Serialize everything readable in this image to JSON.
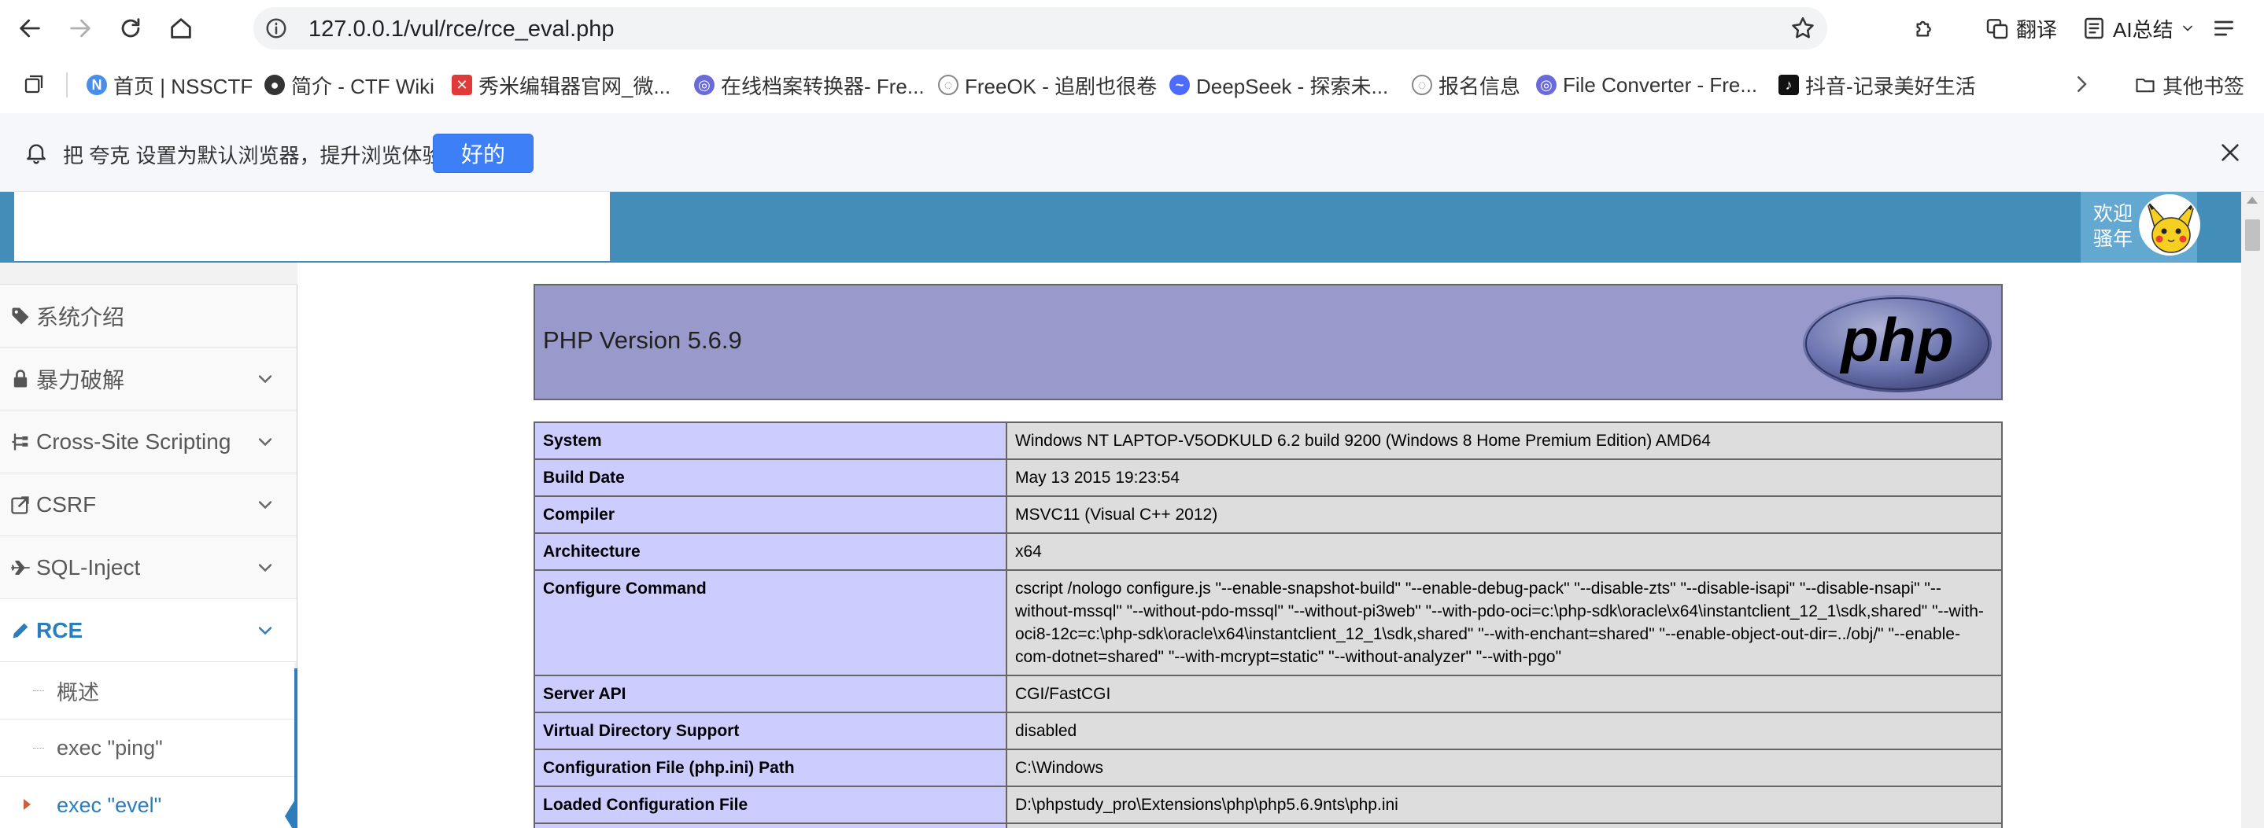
{
  "browser": {
    "url": "127.0.0.1/vul/rce/rce_eval.php",
    "translate_label": "翻译",
    "ai_summary_label": "AI总结"
  },
  "bookmarks": {
    "items": [
      {
        "label": "首页 | NSSCTF",
        "color": "#4a8fe7"
      },
      {
        "label": "简介 - CTF Wiki",
        "color": "#333333"
      },
      {
        "label": "秀米编辑器官网_微...",
        "color": "#e03a3a"
      },
      {
        "label": "在线档案转换器- Fre...",
        "color": "#6a6ad8"
      },
      {
        "label": "FreeOK - 追剧也很卷",
        "color": "#888888"
      },
      {
        "label": "DeepSeek - 探索未...",
        "color": "#4d6bfe"
      },
      {
        "label": "报名信息",
        "color": "#888888"
      },
      {
        "label": "File Converter - Fre...",
        "color": "#6a6ad8"
      },
      {
        "label": "抖音-记录美好生活",
        "color": "#111111"
      }
    ],
    "other_label": "其他书签"
  },
  "notify": {
    "text": "把 夸克 设置为默认浏览器，提升浏览体验",
    "ok_label": "好的"
  },
  "header": {
    "welcome": "欢迎 骚年"
  },
  "sidebar": {
    "items": [
      {
        "label": "系统介绍",
        "icon": "tag-icon"
      },
      {
        "label": "暴力破解",
        "icon": "lock-icon"
      },
      {
        "label": "Cross-Site Scripting",
        "icon": "sitemap-icon"
      },
      {
        "label": "CSRF",
        "icon": "share-square-icon"
      },
      {
        "label": "SQL-Inject",
        "icon": "plane-icon"
      },
      {
        "label": "RCE",
        "icon": "pencil-icon"
      }
    ],
    "sub_items": [
      {
        "label": "概述"
      },
      {
        "label": "exec \"ping\""
      },
      {
        "label": "exec \"evel\""
      }
    ]
  },
  "phpinfo": {
    "version": "PHP Version 5.6.9",
    "rows": [
      {
        "key": "System",
        "value": "Windows NT LAPTOP-V5ODKULD 6.2 build 9200 (Windows 8 Home Premium Edition) AMD64"
      },
      {
        "key": "Build Date",
        "value": "May 13 2015 19:23:54"
      },
      {
        "key": "Compiler",
        "value": "MSVC11 (Visual C++ 2012)"
      },
      {
        "key": "Architecture",
        "value": "x64"
      },
      {
        "key": "Configure Command",
        "value": "cscript /nologo configure.js \"--enable-snapshot-build\" \"--enable-debug-pack\" \"--disable-zts\" \"--disable-isapi\" \"--disable-nsapi\" \"--without-mssql\" \"--without-pdo-mssql\" \"--without-pi3web\" \"--with-pdo-oci=c:\\php-sdk\\oracle\\x64\\instantclient_12_1\\sdk,shared\" \"--with-oci8-12c=c:\\php-sdk\\oracle\\x64\\instantclient_12_1\\sdk,shared\" \"--with-enchant=shared\" \"--enable-object-out-dir=../obj/\" \"--enable-com-dotnet=shared\" \"--with-mcrypt=static\" \"--without-analyzer\" \"--with-pgo\""
      },
      {
        "key": "Server API",
        "value": "CGI/FastCGI"
      },
      {
        "key": "Virtual Directory Support",
        "value": "disabled"
      },
      {
        "key": "Configuration File (php.ini) Path",
        "value": "C:\\Windows"
      },
      {
        "key": "Loaded Configuration File",
        "value": "D:\\phpstudy_pro\\Extensions\\php\\php5.6.9nts\\php.ini"
      },
      {
        "key": "",
        "value": ""
      }
    ]
  }
}
